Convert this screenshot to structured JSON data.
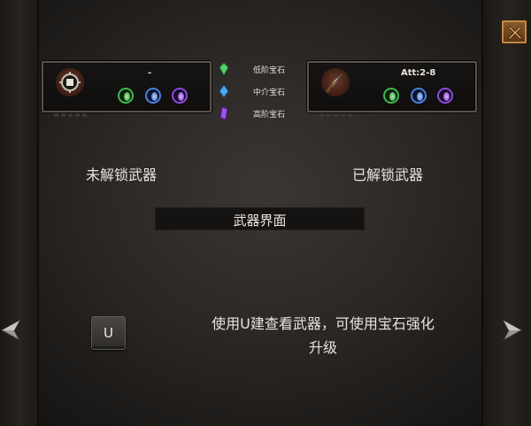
{
  "close_button": {
    "icon": "close-icon"
  },
  "locked_card": {
    "title": "-",
    "icon": "gear-weapon-icon",
    "gems": [
      "green",
      "blue",
      "purple"
    ]
  },
  "unlocked_card": {
    "title": "Att:2-8",
    "icon": "dagger-icon",
    "gems": [
      "green",
      "blue",
      "purple"
    ]
  },
  "gem_legend": [
    {
      "label": "低阶宝石",
      "color": "#4fd06a"
    },
    {
      "label": "中介宝石",
      "color": "#4aa8f0"
    },
    {
      "label": "高阶宝石",
      "color": "#a050f0"
    }
  ],
  "captions": {
    "locked": "未解锁武器",
    "unlocked": "已解锁武器"
  },
  "banner": {
    "label": "武器界面"
  },
  "hotkey": {
    "key": "U"
  },
  "instruction": {
    "line1": "使用U建查看武器，可使用宝石强化",
    "line2": "升级"
  },
  "colors": {
    "accent_gold": "#c08a4a",
    "text": "#e8e4dc",
    "background": "#2a2725"
  }
}
